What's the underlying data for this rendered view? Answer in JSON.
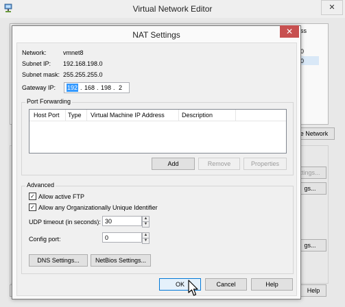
{
  "parent": {
    "title": "Virtual Network Editor",
    "close_glyph": "✕",
    "table_header_fragment": "ss",
    "row_values": [
      "0",
      "0"
    ],
    "buttons": {
      "remove_network": "e Network",
      "settings1": "ttings...",
      "settings2": "gs...",
      "settings3": "gs...",
      "help": "Help"
    }
  },
  "dialog": {
    "title": "NAT Settings",
    "close_glyph": "✕",
    "network_label": "Network:",
    "network_value": "vmnet8",
    "subnet_ip_label": "Subnet IP:",
    "subnet_ip_value": "192.168.198.0",
    "subnet_mask_label": "Subnet mask:",
    "subnet_mask_value": "255.255.255.0",
    "gateway_label": "Gateway IP:",
    "gateway_octets": [
      "192",
      "168",
      "198",
      "2"
    ],
    "gateway_dot": ".",
    "port_forwarding": {
      "title": "Port Forwarding",
      "columns": [
        "Host Port",
        "Type",
        "Virtual Machine IP Address",
        "Description"
      ],
      "add": "Add",
      "remove": "Remove",
      "properties": "Properties"
    },
    "advanced": {
      "title": "Advanced",
      "allow_ftp": "Allow active FTP",
      "allow_oui": "Allow any Organizationally Unique Identifier",
      "check_glyph": "✓",
      "udp_label": "UDP timeout (in seconds):",
      "udp_value": "30",
      "config_port_label": "Config port:",
      "config_port_value": "0",
      "spin_up": "▲",
      "spin_down": "▼",
      "dns_button": "DNS Settings...",
      "netbios_button": "NetBios Settings..."
    },
    "ok": "OK",
    "cancel": "Cancel",
    "help": "Help"
  },
  "colors": {
    "close_red": "#c75050",
    "selection_blue": "#3399ff",
    "focus_blue": "#0078d7"
  }
}
